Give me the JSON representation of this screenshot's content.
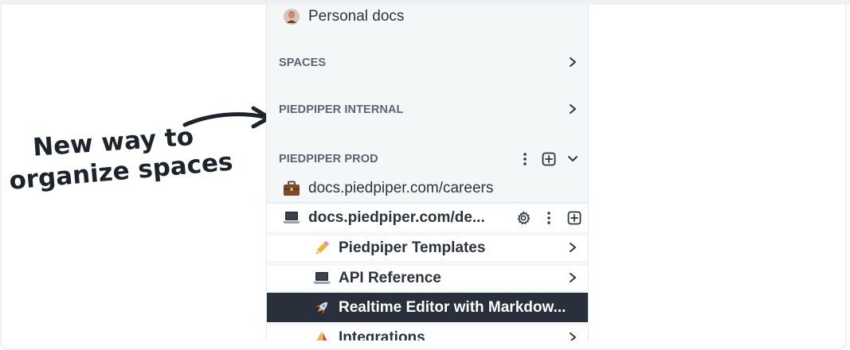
{
  "annotation": {
    "line1": "New way to",
    "line2": "organize spaces"
  },
  "sidebar": {
    "personal": {
      "label": "Personal docs",
      "icon": "avatar"
    },
    "sections": [
      {
        "label": "SPACES",
        "icon": "chevron-right-icon"
      },
      {
        "label": "PIEDPIPER INTERNAL",
        "icon": "chevron-right-icon"
      },
      {
        "label": "PIEDPIPER PROD",
        "icon": "chevron-down-icon"
      }
    ],
    "spaces": [
      {
        "label": "docs.piedpiper.com/careers",
        "icon": "briefcase-icon"
      },
      {
        "label": "docs.piedpiper.com/de...",
        "icon": "laptop-icon"
      }
    ],
    "pages": [
      {
        "label": "Piedpiper Templates",
        "icon": "pencil-icon"
      },
      {
        "label": "API Reference",
        "icon": "laptop-icon"
      },
      {
        "label": "Realtime Editor with Markdow...",
        "icon": "rocket-icon",
        "selected": true
      },
      {
        "label": "Integrations",
        "icon": "sailboat-icon"
      }
    ]
  },
  "colors": {
    "sidebar_bg": "#f3f7f8",
    "selected_bg": "#29303b",
    "section_text": "#5b6572"
  }
}
